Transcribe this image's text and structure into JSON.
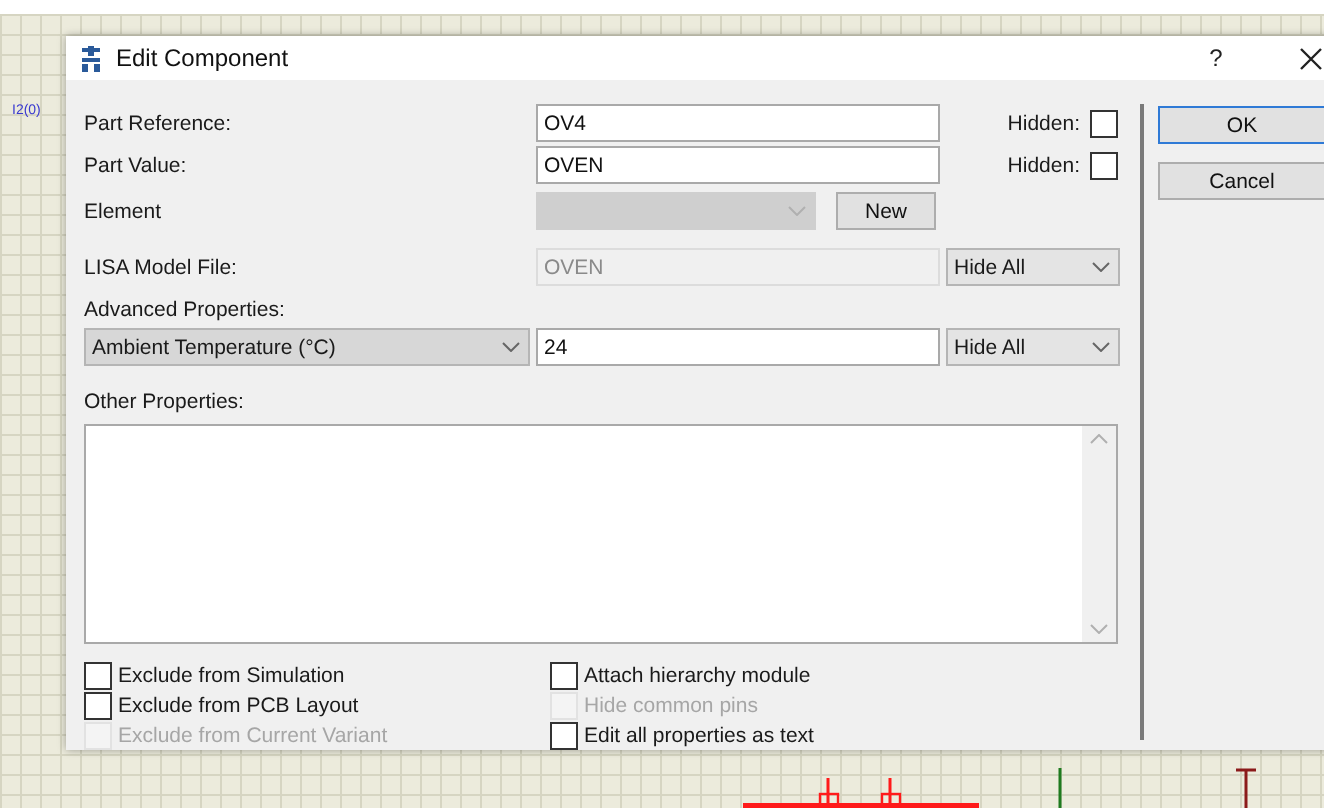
{
  "canvas": {
    "net_label": "I2(0)"
  },
  "window": {
    "title": "Edit Component",
    "help": "?"
  },
  "part_reference": {
    "label": "Part Reference:",
    "value": "OV4",
    "hidden_label": "Hidden:",
    "hidden_checked": false
  },
  "part_value": {
    "label": "Part Value:",
    "value": "OVEN",
    "hidden_label": "Hidden:",
    "hidden_checked": false
  },
  "element": {
    "label": "Element",
    "disabled": true,
    "new_button": "New"
  },
  "lisa_model_file": {
    "label": "LISA Model File:",
    "value": "OVEN",
    "disabled": true,
    "visibility": "Hide All"
  },
  "advanced_properties": {
    "label": "Advanced Properties:",
    "property": "Ambient Temperature (°C)",
    "value": "24",
    "visibility": "Hide All"
  },
  "other_properties": {
    "label": "Other Properties:"
  },
  "options_left": [
    {
      "label": "Exclude from Simulation",
      "checked": false,
      "disabled": false
    },
    {
      "label": "Exclude from PCB Layout",
      "checked": false,
      "disabled": false
    },
    {
      "label": "Exclude from Current Variant",
      "checked": false,
      "disabled": true
    }
  ],
  "options_right": [
    {
      "label": "Attach hierarchy module",
      "checked": false,
      "disabled": false
    },
    {
      "label": "Hide common pins",
      "checked": false,
      "disabled": true
    },
    {
      "label": "Edit all properties as text",
      "checked": false,
      "disabled": false
    }
  ],
  "buttons": [
    {
      "label": "OK",
      "default": true
    },
    {
      "label": "Cancel",
      "default": false
    }
  ]
}
